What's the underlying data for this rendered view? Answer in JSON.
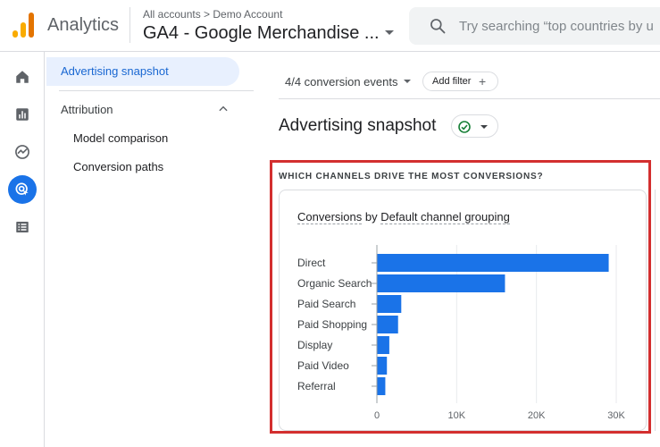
{
  "header": {
    "app_name": "Analytics",
    "breadcrumb": "All accounts > Demo Account",
    "property": "GA4 - Google Merchandise ...",
    "search_placeholder": "Try searching “top countries by u"
  },
  "rail": {
    "items": [
      {
        "icon": "home-icon",
        "active": false
      },
      {
        "icon": "reports-icon",
        "active": false
      },
      {
        "icon": "explore-icon",
        "active": false
      },
      {
        "icon": "advertising-icon",
        "active": true
      },
      {
        "icon": "configure-icon",
        "active": false
      }
    ]
  },
  "subnav": {
    "active_item": "Advertising snapshot",
    "section": "Attribution",
    "items": [
      "Model comparison",
      "Conversion paths"
    ]
  },
  "toolbar": {
    "conversion_events": "4/4 conversion events",
    "add_filter": "Add filter"
  },
  "page": {
    "title": "Advertising snapshot"
  },
  "section": {
    "title": "WHICH CHANNELS DRIVE THE MOST CONVERSIONS?"
  },
  "card": {
    "metric": "Conversions",
    "by": "by",
    "dimension": "Default channel grouping"
  },
  "colors": {
    "bar": "#1a73e8",
    "highlight_border": "#d32f2f",
    "accent": "#1967d2"
  },
  "chart_data": {
    "type": "bar",
    "orientation": "horizontal",
    "categories": [
      "Direct",
      "Organic Search",
      "Paid Search",
      "Paid Shopping",
      "Display",
      "Paid Video",
      "Referral"
    ],
    "values": [
      29000,
      16000,
      3000,
      2600,
      1500,
      1200,
      1000
    ],
    "xticks": [
      "0",
      "10K",
      "20K",
      "30K"
    ],
    "xlim": [
      0,
      30000
    ],
    "grid": true
  }
}
